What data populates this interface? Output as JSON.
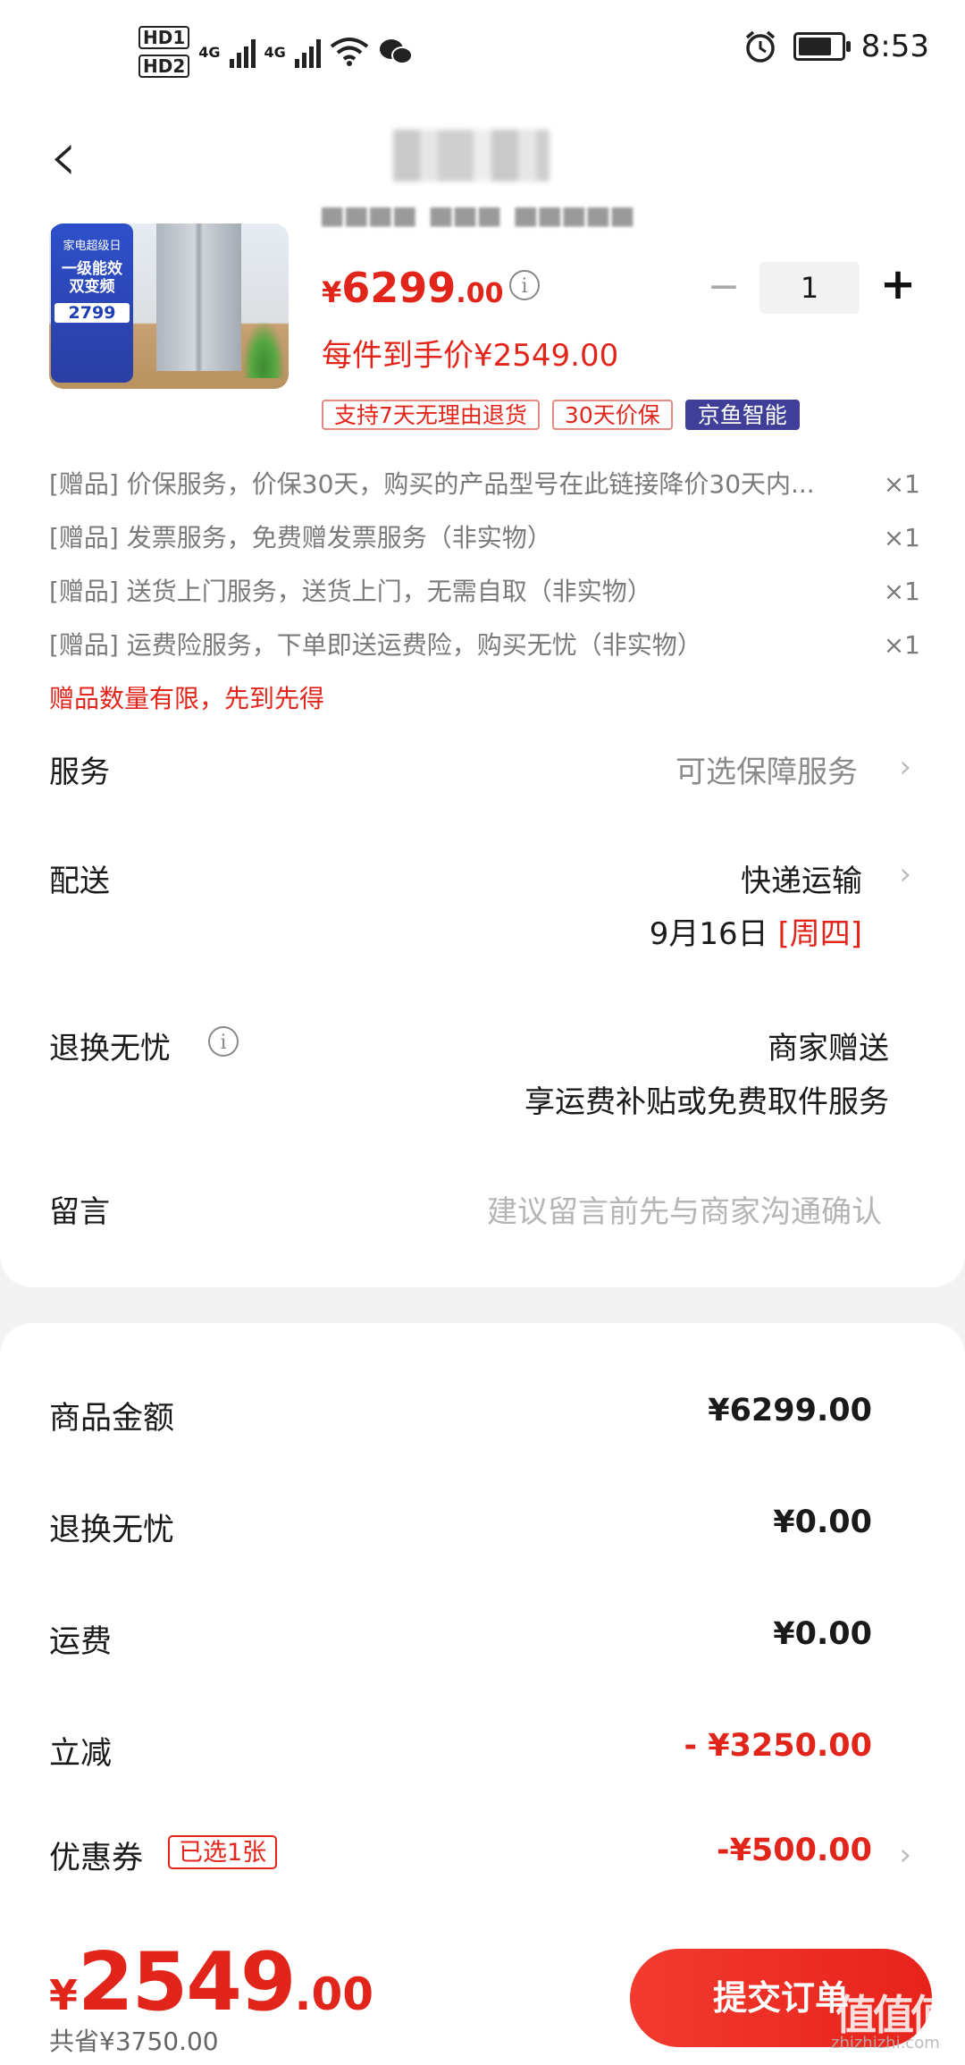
{
  "status_bar": {
    "hd1": "HD1",
    "hd2": "HD2",
    "net1": "4G",
    "net2": "4G",
    "time": "8:53"
  },
  "product": {
    "promo_line1": "家电超级日",
    "promo_big": "一级能效\n双变频",
    "promo_price": "2799",
    "price_symbol": "¥",
    "price_int": "6299",
    "price_dec": ".00",
    "quantity": "1",
    "hand_price": "每件到手价¥2549.00",
    "tags": [
      "支持7天无理由退货",
      "30天价保",
      "京鱼智能"
    ]
  },
  "gifts": [
    {
      "text": "[赠品] 价保服务，价保30天，购买的产品型号在此链接降价30天内...",
      "count": "×1"
    },
    {
      "text": "[赠品] 发票服务，免费赠发票服务（非实物）",
      "count": "×1"
    },
    {
      "text": "[赠品] 送货上门服务，送货上门，无需自取（非实物）",
      "count": "×1"
    },
    {
      "text": "[赠品] 运费险服务，下单即送运费险，购买无忧（非实物）",
      "count": "×1"
    }
  ],
  "gift_note": "赠品数量有限，先到先得",
  "service": {
    "label": "服务",
    "value": "可选保障服务"
  },
  "delivery": {
    "label": "配送",
    "method": "快递运输",
    "date": "9月16日",
    "weekday": "[周四]"
  },
  "return": {
    "label": "退换无忧",
    "line1": "商家赠送",
    "line2": "享运费补贴或免费取件服务"
  },
  "message": {
    "label": "留言",
    "placeholder": "建议留言前先与商家沟通确认"
  },
  "summary": {
    "goods_label": "商品金额",
    "goods_value": "¥6299.00",
    "return_label": "退换无忧",
    "return_value": "¥0.00",
    "freight_label": "运费",
    "freight_value": "¥0.00",
    "discount_label": "立减",
    "discount_value": "- ¥3250.00",
    "coupon_label": "优惠券",
    "coupon_tag": "已选1张",
    "coupon_value": "-¥500.00"
  },
  "footer": {
    "total_symbol": "¥",
    "total_int": "2549",
    "total_dec": ".00",
    "saved": "共省¥3750.00",
    "submit_label": "提交订单",
    "watermark": "值值值",
    "watermark_url": "zhizhizhi.com"
  },
  "colors": {
    "accent": "#e1251b",
    "tag_blue": "#3f3f9a"
  }
}
